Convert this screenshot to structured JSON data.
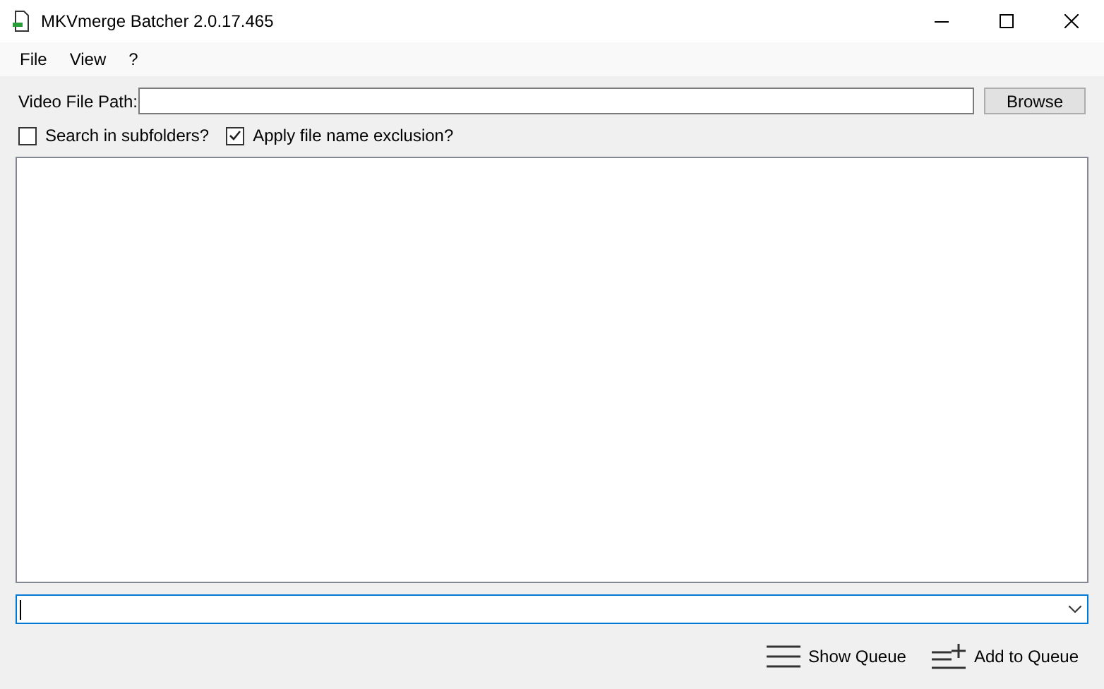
{
  "window": {
    "title": "MKVmerge Batcher 2.0.17.465"
  },
  "menu": [
    "File",
    "View",
    "?"
  ],
  "path_field": {
    "label": "Video File Path:"
  },
  "browse_button": "Browse",
  "options": [
    {
      "label": "Search in subfolders?",
      "checked": false
    },
    {
      "label": "Apply file name exclusion?",
      "checked": true
    }
  ],
  "combo": {
    "focused": true
  },
  "actions": [
    {
      "label": "Show Queue",
      "kind": "show"
    },
    {
      "label": "Add to Queue",
      "kind": "add"
    }
  ]
}
